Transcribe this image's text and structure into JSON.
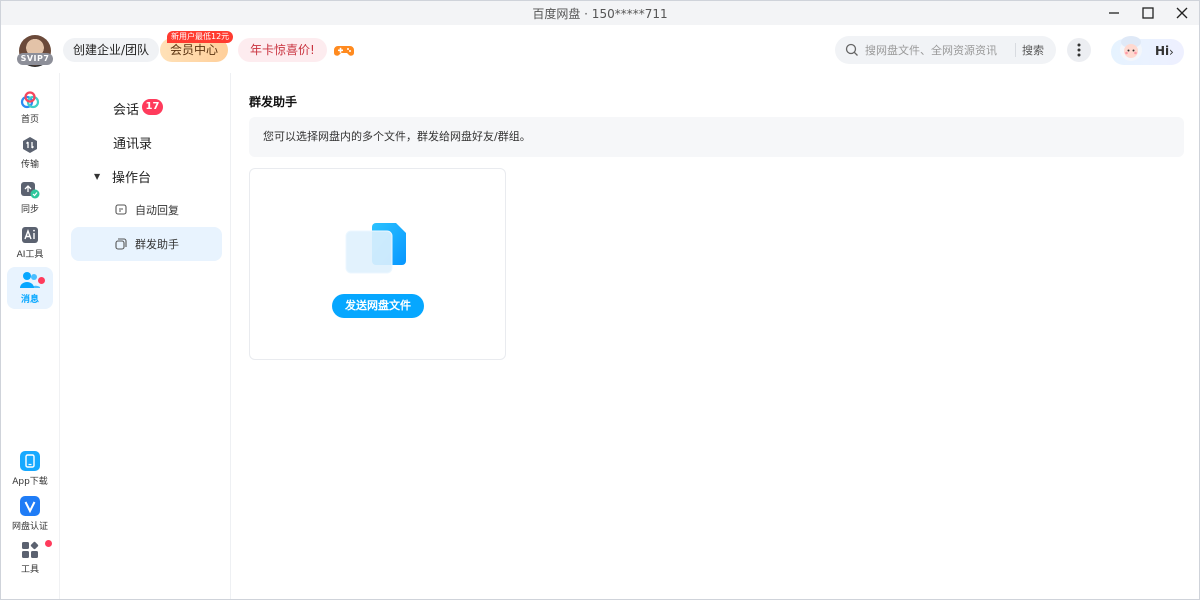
{
  "window": {
    "title": "百度网盘 · 150*****711"
  },
  "header": {
    "avatar_badge": "SVIP7",
    "enterprise_label": "创建企业/团队",
    "vip_label": "会员中心",
    "vip_promo": "新用户最低12元",
    "annual_label": "年卡惊喜价!",
    "search_placeholder": "搜网盘文件、全网资源资讯",
    "search_button": "搜索",
    "hi_label": "Hi",
    "hi_chevron": "›"
  },
  "rail": {
    "items": [
      {
        "label": "首页",
        "icon": "home-cloud-icon"
      },
      {
        "label": "传输",
        "icon": "transfer-icon"
      },
      {
        "label": "同步",
        "icon": "sync-icon"
      },
      {
        "label": "AI工具",
        "icon": "ai-tool-icon"
      },
      {
        "label": "消息",
        "icon": "message-icon"
      }
    ],
    "bottom_items": [
      {
        "label": "App下载",
        "icon": "app-download-icon"
      },
      {
        "label": "网盘认证",
        "icon": "verify-icon"
      },
      {
        "label": "工具",
        "icon": "tools-icon"
      }
    ]
  },
  "subnav": {
    "chat": "会话",
    "chat_count": "17",
    "contacts": "通讯录",
    "workbench": "操作台",
    "auto_reply": "自动回复",
    "mass_send": "群发助手"
  },
  "main": {
    "title": "群发助手",
    "info": "您可以选择网盘内的多个文件，群发给网盘好友/群组。",
    "send_button": "发送网盘文件"
  },
  "colors": {
    "accent": "#06a7ff",
    "badge_red": "#ff3b5c",
    "active_bg": "#e8f3fe"
  }
}
